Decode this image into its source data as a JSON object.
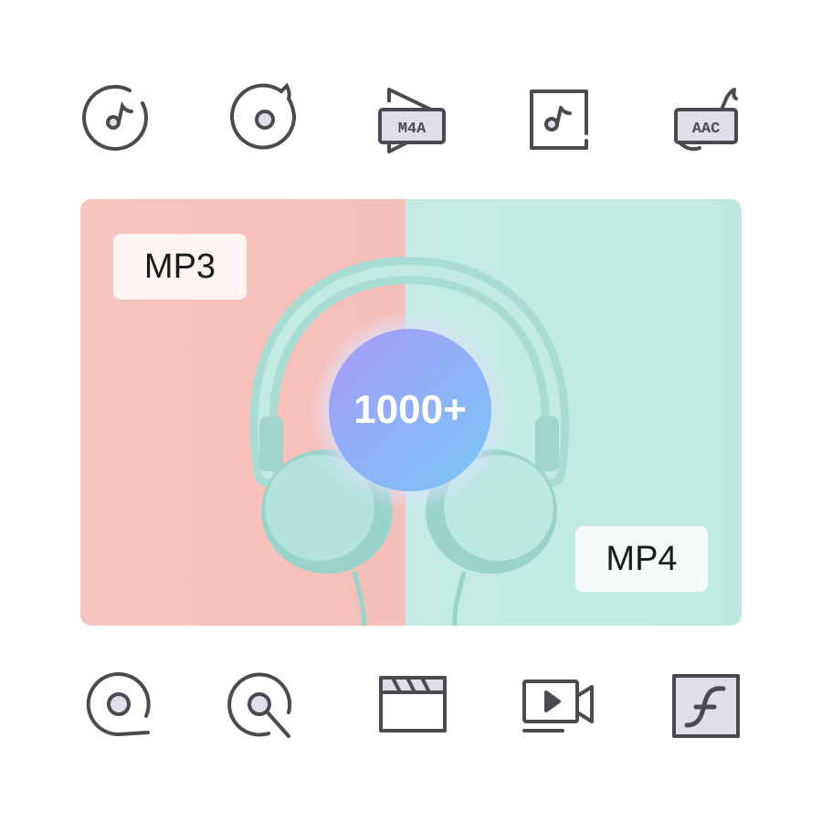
{
  "hero": {
    "badge_text": "1000+",
    "left_tag": "MP3",
    "right_tag": "MP4",
    "left_color": "#f6c0ba",
    "right_color": "#c5ebe3"
  },
  "icons": {
    "top": [
      {
        "name": "disc-music-icon"
      },
      {
        "name": "cd-music-icon"
      },
      {
        "name": "m4a-radio-icon",
        "text": "M4A"
      },
      {
        "name": "music-file-icon"
      },
      {
        "name": "aac-radio-icon",
        "text": "AAC"
      }
    ],
    "bottom": [
      {
        "name": "disc-icon"
      },
      {
        "name": "disc-search-icon"
      },
      {
        "name": "clapperboard-icon"
      },
      {
        "name": "video-camera-icon"
      },
      {
        "name": "flash-icon"
      }
    ]
  },
  "colors": {
    "icon_stroke": "#4a4a4f",
    "icon_fill": "#dedfe8"
  }
}
